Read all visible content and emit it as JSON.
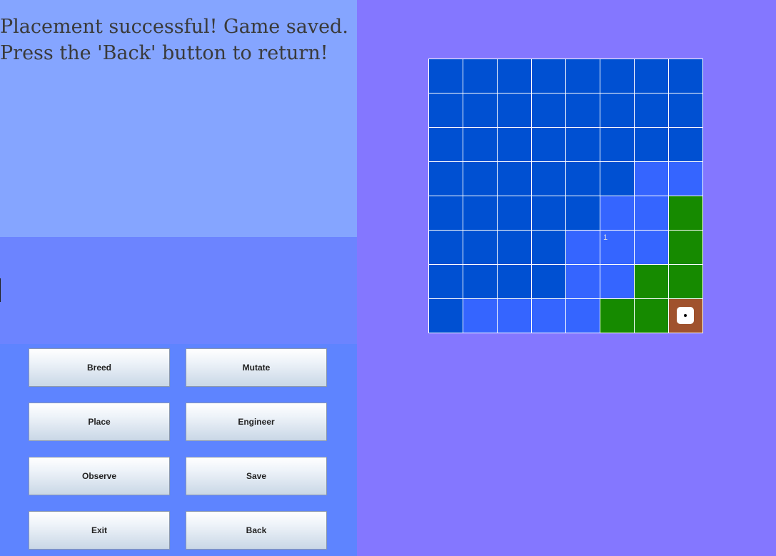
{
  "message": {
    "line1": "Placement successful! Game saved.",
    "line2": "Press the 'Back' button to return!"
  },
  "buttons": {
    "breed": "Breed",
    "mutate": "Mutate",
    "place": "Place",
    "engineer": "Engineer",
    "observe": "Observe",
    "save": "Save",
    "exit": "Exit",
    "back": "Back"
  },
  "colors": {
    "deep_water": "#0050d2",
    "shallow_water": "#3565ff",
    "grass": "#168a00",
    "soil": "#a0522d"
  },
  "board": {
    "rows": [
      [
        "D",
        "D",
        "D",
        "D",
        "D",
        "D",
        "D",
        "D"
      ],
      [
        "D",
        "D",
        "D",
        "D",
        "D",
        "D",
        "D",
        "D"
      ],
      [
        "D",
        "D",
        "D",
        "D",
        "D",
        "D",
        "D",
        "D"
      ],
      [
        "D",
        "D",
        "D",
        "D",
        "D",
        "D",
        "S",
        "S"
      ],
      [
        "D",
        "D",
        "D",
        "D",
        "D",
        "S",
        "S",
        "G"
      ],
      [
        "D",
        "D",
        "D",
        "D",
        "S",
        "S",
        "S",
        "G"
      ],
      [
        "D",
        "D",
        "D",
        "D",
        "S",
        "S",
        "G",
        "G"
      ],
      [
        "D",
        "S",
        "S",
        "S",
        "S",
        "G",
        "G",
        "P"
      ]
    ],
    "labels": [
      {
        "row": 5,
        "col": 5,
        "text": "1"
      }
    ],
    "piece": {
      "row": 7,
      "col": 7,
      "icon": "die-face-one"
    }
  }
}
